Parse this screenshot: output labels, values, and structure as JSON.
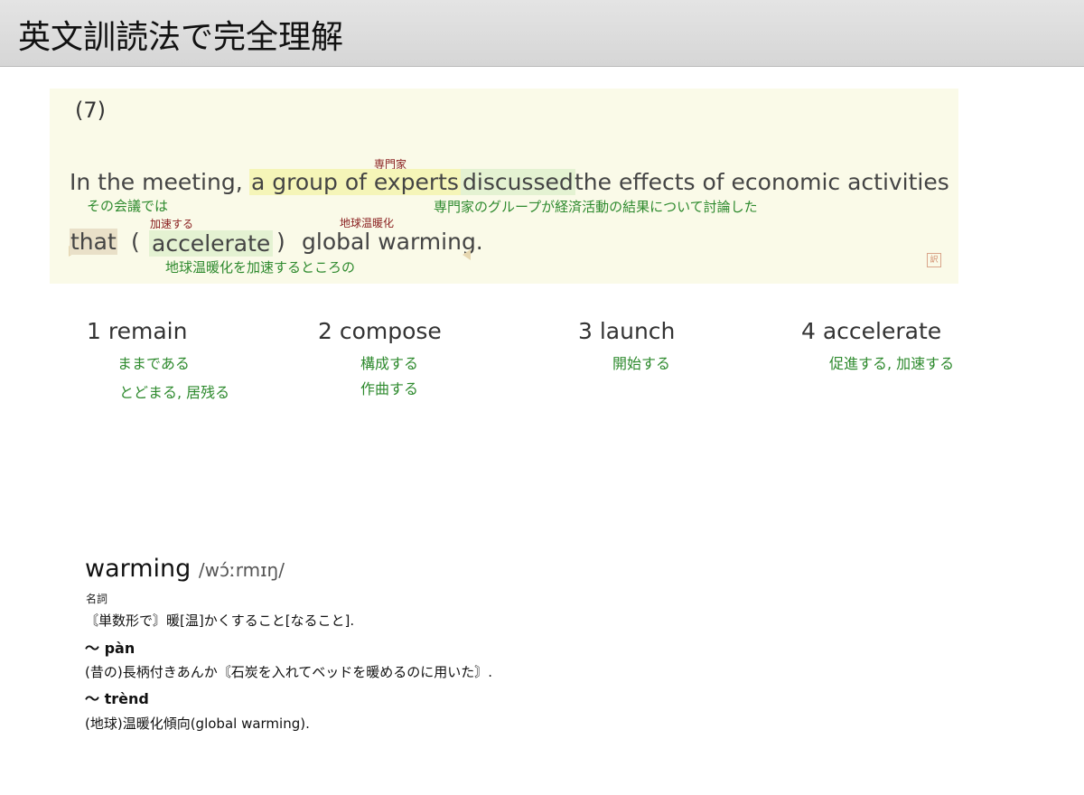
{
  "header": {
    "title": "英文訓読法で完全理解"
  },
  "question": {
    "number": "(7)",
    "line1": {
      "p1": "In the meeting,",
      "p2": "a group of experts",
      "p3": "discussed",
      "p4": "the effects of economic activities",
      "ruby_experts": "専門家",
      "gloss_meeting": "その会議では",
      "gloss_main": "専門家のグループが経済活動の結果について討論した"
    },
    "line2": {
      "that": "that",
      "open_paren": "(",
      "answer": "accelerate",
      "close_paren": ")",
      "rest": "global warming.",
      "ruby_answer": "加速する",
      "ruby_warming": "地球温暖化",
      "gloss": "地球温暖化を加速するところの"
    },
    "stamp": "訳"
  },
  "choices": [
    {
      "label": "1 remain",
      "glosses": [
        "ままである",
        "とどまる, 居残る"
      ]
    },
    {
      "label": "2 compose",
      "glosses": [
        "構成する",
        "作曲する"
      ]
    },
    {
      "label": "3 launch",
      "glosses": [
        "開始する"
      ]
    },
    {
      "label": "4 accelerate",
      "glosses": [
        "促進する, 加速する"
      ]
    }
  ],
  "dictionary": {
    "word": "warming",
    "pronunciation": "/wɔ́ːrmɪŋ/",
    "pos": "名詞",
    "definition": "〘単数形で〙暖[温]かくすること[なること].",
    "phrase1": "〜 pàn",
    "phrase1_def": "(昔の)長柄付きあんか〘石炭を入れてベッドを暖めるのに用いた〙.",
    "phrase2": "〜 trènd",
    "phrase2_def": "(地球)温暖化傾向(global warming)."
  },
  "colors": {
    "gloss_green": "#2e8a2e",
    "ruby_red": "#8a2020",
    "panel_bg": "#fafae8"
  }
}
